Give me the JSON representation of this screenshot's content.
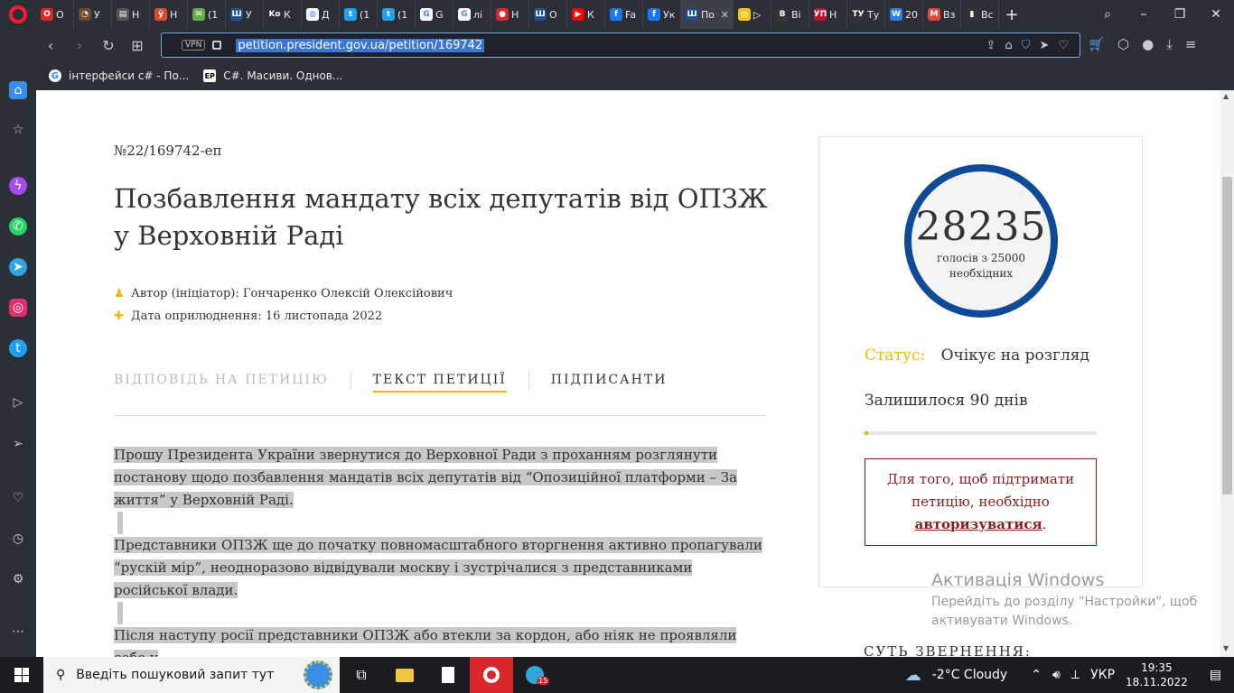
{
  "browser": {
    "tabs": [
      {
        "fav": "O",
        "label": "О",
        "color": "#d8262a"
      },
      {
        "fav": "◔",
        "label": "У",
        "color": "#6b4b2a"
      },
      {
        "fav": "▤",
        "label": "Н",
        "color": "#555555"
      },
      {
        "fav": "ӯ",
        "label": "Н",
        "color": "#e04a2a"
      },
      {
        "fav": "✉",
        "label": "(1",
        "color": "#6aa84f"
      },
      {
        "fav": "Ш",
        "label": "У",
        "color": "#1d4f91"
      },
      {
        "fav": "Ko",
        "label": "К",
        "color": "#2b2f36"
      },
      {
        "fav": "◍",
        "label": "Д",
        "color": "#ffffff"
      },
      {
        "fav": "t",
        "label": "(1",
        "color": "#1da1f2"
      },
      {
        "fav": "t",
        "label": "(1",
        "color": "#1da1f2"
      },
      {
        "fav": "G",
        "label": "G",
        "color": "#ffffff"
      },
      {
        "fav": "G",
        "label": "лі",
        "color": "#ffffff"
      },
      {
        "fav": "●",
        "label": "Н",
        "color": "#d8262a"
      },
      {
        "fav": "Ш",
        "label": "О",
        "color": "#1d4f91"
      },
      {
        "fav": "▶",
        "label": "К",
        "color": "#ff0000"
      },
      {
        "fav": "f",
        "label": "Fa",
        "color": "#1877f2"
      },
      {
        "fav": "f",
        "label": "Ук",
        "color": "#1877f2"
      },
      {
        "fav": "Ш",
        "label": "По",
        "color": "#1d4f91",
        "active": true
      },
      {
        "fav": "◎",
        "label": "▷",
        "color": "#f5c518"
      },
      {
        "fav": "B",
        "label": "Ві",
        "color": "#333333"
      },
      {
        "fav": "УП",
        "label": "Н",
        "color": "#c8102e"
      },
      {
        "fav": "ТУ",
        "label": "Ту",
        "color": "#333333"
      },
      {
        "fav": "W",
        "label": "20",
        "color": "#2b7de9"
      },
      {
        "fav": "M",
        "label": "Вз",
        "color": "#ea4335"
      },
      {
        "fav": "▮",
        "label": "Вс",
        "color": "#333333"
      }
    ],
    "new_tab": "+",
    "url": "petition.president.gov.ua/petition/169742",
    "vpn": "VPN",
    "bookmarks": [
      {
        "fav": "G",
        "label": "інтерфейси c# - По..."
      },
      {
        "fav": "EP",
        "label": "C#. Масиви. Однов..."
      }
    ]
  },
  "page": {
    "petition_number": "№22/169742-еп",
    "title": "Позбавлення мандату всіх депутатів від ОПЗЖ у Верховній Раді",
    "author": "Автор (ініціатор): Гончаренко Олексій Олексійович",
    "published": "Дата оприлюднення: 16 листопада 2022",
    "tabs": {
      "answer": "ВІДПОВІДЬ НА ПЕТИЦІЮ",
      "text": "ТЕКСТ ПЕТИЦІЇ",
      "signers": "ПІДПИСАНТИ"
    },
    "paragraphs": [
      "Прошу Президента України звернутися до Верховної Ради з проханням розглянути постанову щодо позбавлення мандатів всіх депутатів від “Опозиційної платформи – За життя” у Верховній Раді.",
      "Представники ОПЗЖ ще до початку повномасштабного вторгнення активно пропагували “рускій мір”, неодноразово відвідували москву і зустрічалися з представниками російської влади.",
      "Після наступу росії представники ОПЗЖ або втекли за кордон, або ніяк не проявляли себе у"
    ],
    "votes": "28235",
    "votes_caption_1": "голосів з 25000",
    "votes_caption_2": "необхідних",
    "progress": 1.0,
    "status_label": "Статус:",
    "status_value": "Очікує на розгляд",
    "days_left": "Залишилося 90 днів",
    "auth_pre": "Для того, щоб підтримати петицію, необхідно",
    "auth_link": "авторизуватися",
    "auth_post": ".",
    "essence_heading": "СУТЬ ЗВЕРНЕННЯ:"
  },
  "watermark": {
    "title": "Активація Windows",
    "line1": "Перейдіть до розділу \"Настройки\", щоб",
    "line2": "активувати Windows."
  },
  "taskbar": {
    "search_placeholder": "Введіть пошуковий запит тут",
    "weather": "-2°C  Cloudy",
    "lang": "УКР",
    "time": "19:35",
    "date": "18.11.2022",
    "tg_badge": "15"
  }
}
